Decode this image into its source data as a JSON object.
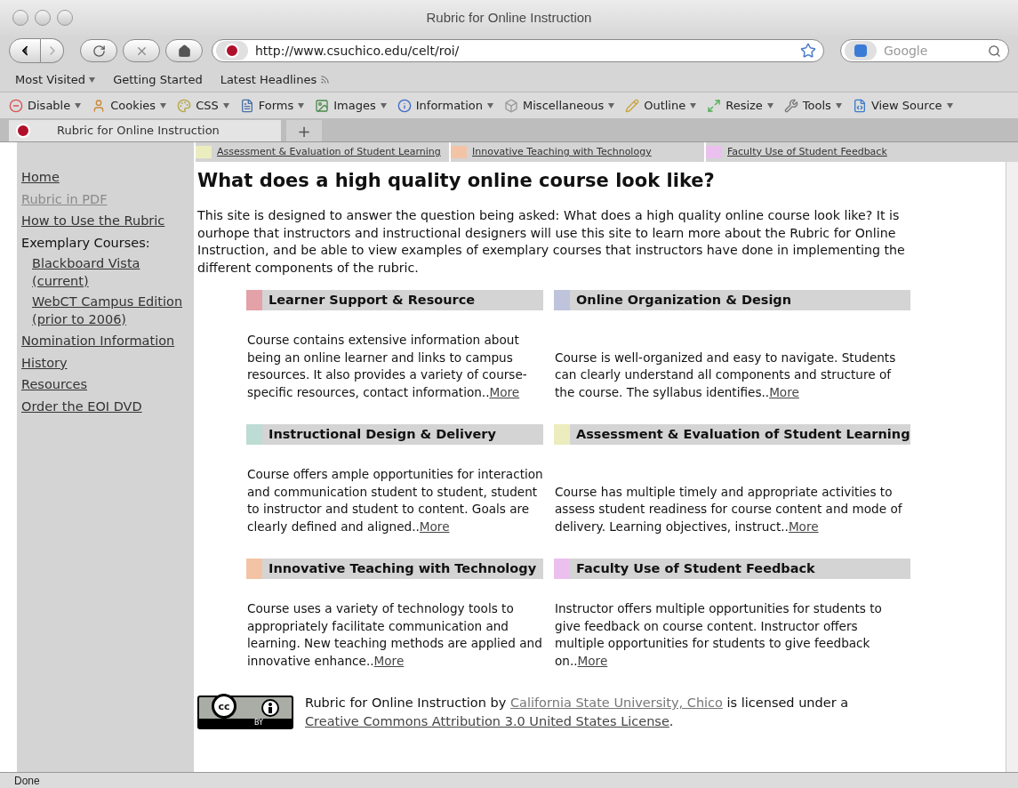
{
  "window": {
    "title": "Rubric for Online Instruction"
  },
  "navbar": {
    "url": "http://www.csuchico.edu/celt/roi/",
    "search_placeholder": "Google"
  },
  "bookmarks": [
    {
      "label": "Most Visited",
      "kind": "menu"
    },
    {
      "label": "Getting Started",
      "kind": "link"
    },
    {
      "label": "Latest Headlines",
      "kind": "feed"
    }
  ],
  "devbar": [
    {
      "label": "Disable",
      "kind": "disable"
    },
    {
      "label": "Cookies",
      "kind": "cookies"
    },
    {
      "label": "CSS",
      "kind": "css"
    },
    {
      "label": "Forms",
      "kind": "forms"
    },
    {
      "label": "Images",
      "kind": "images"
    },
    {
      "label": "Information",
      "kind": "info"
    },
    {
      "label": "Miscellaneous",
      "kind": "misc"
    },
    {
      "label": "Outline",
      "kind": "outline"
    },
    {
      "label": "Resize",
      "kind": "resize"
    },
    {
      "label": "Tools",
      "kind": "tools"
    },
    {
      "label": "View Source",
      "kind": "source"
    }
  ],
  "tabs": [
    {
      "label": "Rubric for Online Instruction",
      "selected": true
    }
  ],
  "new_tab": "+",
  "top_links": [
    {
      "label": "Assessment & Evaluation of Student Learning",
      "color": "#ecedbf"
    },
    {
      "label": "Innovative Teaching with Technology",
      "color": "#f3c3a6"
    },
    {
      "label": "Faculty Use of Student Feedback",
      "color": "#ebc0ee"
    }
  ],
  "sidebar": [
    {
      "label": "Home",
      "disabled": false
    },
    {
      "label": "Rubric in PDF",
      "disabled": true
    },
    {
      "label": "How to Use the Rubric",
      "disabled": false
    },
    {
      "label": "Exemplary Courses:",
      "kind": "heading",
      "children": [
        {
          "label": "Blackboard Vista (current)",
          "disabled": false
        },
        {
          "label": "WebCT Campus Edition (prior to 2006)",
          "disabled": false
        }
      ]
    },
    {
      "label": "Nomination Information",
      "disabled": false
    },
    {
      "label": "History",
      "disabled": false
    },
    {
      "label": "Resources",
      "disabled": false
    },
    {
      "label": "Order the EOI DVD",
      "disabled": false
    }
  ],
  "heading": "What does a high quality online course look like?",
  "intro": "This site is designed to answer the question being asked: What does a high quality online course look like? It is ourhope that instructors and instructional designers will use this site to learn more about the Rubric for Online Instruction, and be able to view examples of exemplary courses that instructors have done in implementing the different components of the rubric.",
  "cards": [
    {
      "title": "Learner Support & Resource",
      "color": "#e3a1a8",
      "description": "Course contains extensive information about being an online learner and links to campus resources. It also provides a variety of course-specific resources, contact information..",
      "more": "More"
    },
    {
      "title": "Online Organization & Design",
      "color": "#c0c3dc",
      "description": "Course is well-organized and easy to navigate. Students can clearly understand all components and structure of the course. The syllabus identifies..",
      "more": "More"
    },
    {
      "title": "Instructional Design & Delivery",
      "color": "#bddcd3",
      "description": "Course offers ample opportunities for interaction and communication student to student, student to instructor and student to content. Goals are clearly defined and aligned..",
      "more": "More"
    },
    {
      "title": "Assessment & Evaluation of Student Learning",
      "color": "#ecedbf",
      "description": "Course has multiple timely and appropriate activities to assess student readiness for course content and mode of delivery. Learning objectives, instruct..",
      "more": "More"
    },
    {
      "title": "Innovative Teaching with Technology",
      "color": "#f3c3a6",
      "description": "Course uses a variety of technology tools to appropriately facilitate communication and learning. New teaching methods are applied and innovative enhance..",
      "more": "More"
    },
    {
      "title": "Faculty Use of Student Feedback",
      "color": "#ebc0ee",
      "description": "Instructor offers multiple opportunities for students to give feedback on course content. Instructor offers multiple opportunities for students to give feedback on..",
      "more": "More"
    }
  ],
  "license": {
    "badge_top": "cc",
    "badge_bottom": "BY",
    "before": "Rubric for Online Instruction by ",
    "author": "California State University, Chico",
    "middle": " is licensed under a ",
    "license_link": "Creative Commons Attribution 3.0 United States License",
    "end": "."
  },
  "status_bar": "Done"
}
